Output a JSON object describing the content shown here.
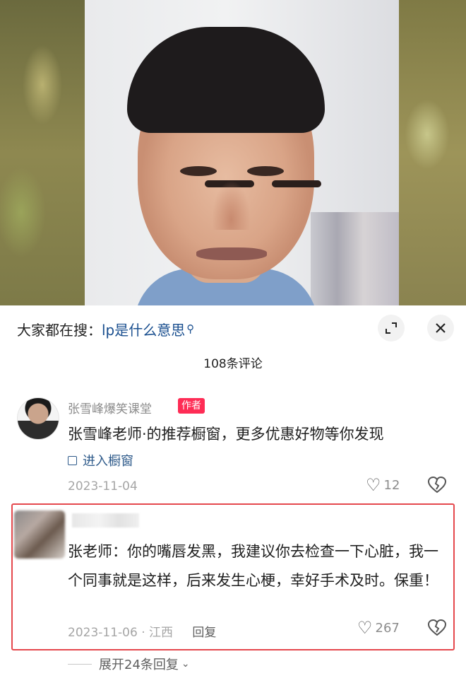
{
  "colors": {
    "accent_red": "#fe2c55",
    "link_blue": "#1a4f8f",
    "highlight_box": "#e5484d"
  },
  "search": {
    "prefix": "大家都在搜：",
    "keyword": "lp是什么意思",
    "icon": "search-icon"
  },
  "header": {
    "expand_icon": "expand-icon",
    "close_icon": "close-icon",
    "comment_count": "108条评论"
  },
  "comments": [
    {
      "username": "张雪峰爆笑课堂",
      "badge": "作者",
      "text": "张雪峰老师·的推荐橱窗，更多优惠好物等你发现",
      "link_label": "进入橱窗",
      "date": "2023-11-04",
      "likes": "12"
    },
    {
      "text": "张老师：你的嘴唇发黑，我建议你去检查一下心脏，我一个同事就是这样，后来发生心梗，幸好手术及时。保重！",
      "date": "2023-11-06",
      "location": "江西",
      "reply_label": "回复",
      "likes": "267",
      "expand_replies": "展开24条回复"
    }
  ]
}
